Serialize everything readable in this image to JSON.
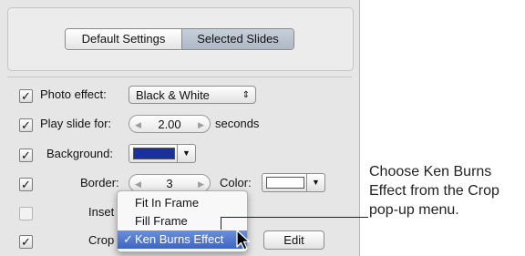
{
  "tabs": {
    "default_settings": "Default Settings",
    "selected_slides": "Selected Slides"
  },
  "rows": {
    "photo_effect": {
      "label": "Photo effect:",
      "value": "Black & White",
      "checked": true
    },
    "play_slide": {
      "label": "Play slide for:",
      "value": "2.00",
      "unit": "seconds",
      "checked": true
    },
    "background": {
      "label": "Background:",
      "color": "#1a2fa0",
      "checked": true
    },
    "border": {
      "label": "Border:",
      "value": "3",
      "color_label": "Color:",
      "color": "#ffffff",
      "checked": true
    },
    "inset": {
      "label": "Inset",
      "checked": false
    },
    "crop": {
      "label": "Crop",
      "edit_label": "Edit",
      "checked": true
    }
  },
  "crop_menu": {
    "items": [
      {
        "label": "Fit In Frame",
        "selected": false
      },
      {
        "label": "Fill Frame",
        "selected": false
      },
      {
        "label": "Ken Burns Effect",
        "selected": true
      }
    ],
    "check_mark": "✓"
  },
  "callout": {
    "text": "Choose Ken Burns\nEffect from the Crop\npop-up menu."
  }
}
